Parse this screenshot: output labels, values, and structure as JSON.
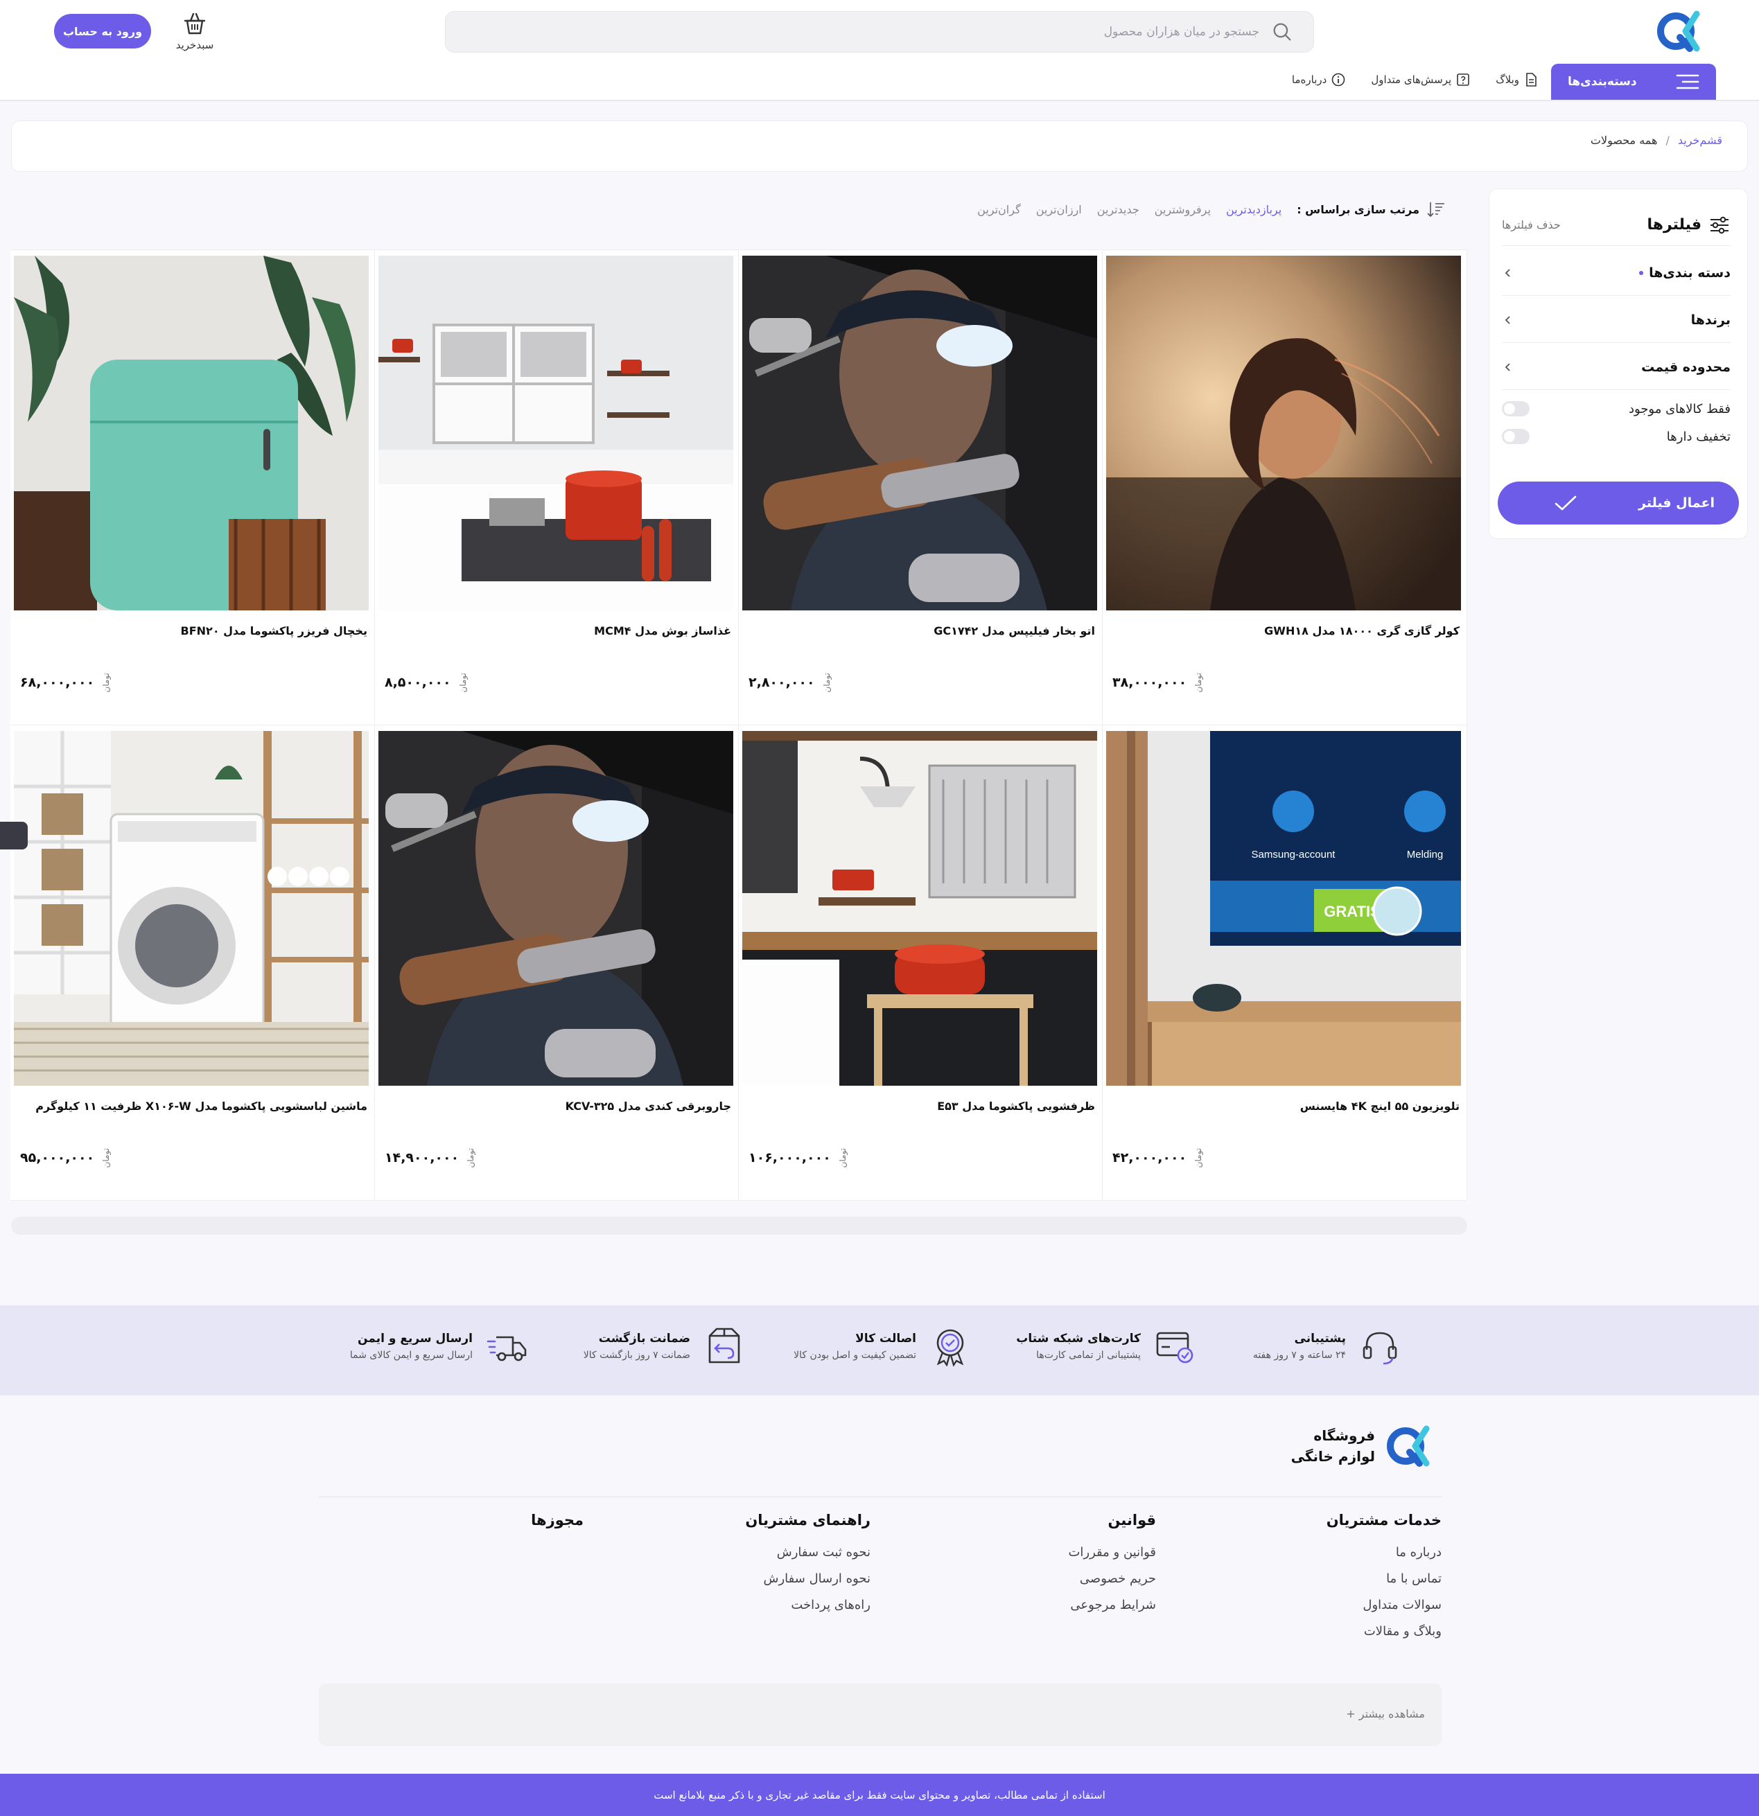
{
  "header": {
    "search_placeholder": "جستجو در میان هزاران محصول",
    "cart_label": "سبدخرید",
    "login_label": "ورود به حساب",
    "categories_label": "دسته‌بندی‌ها",
    "nav": [
      {
        "label": "وبلاگ",
        "icon": "document-icon"
      },
      {
        "label": "پرسش‌های متداول",
        "icon": "question-icon"
      },
      {
        "label": "درباره‌ما",
        "icon": "info-icon"
      }
    ],
    "brand_color": "#6c5ce7"
  },
  "breadcrumb": {
    "home": "قشم‌خرید",
    "sep": "/",
    "current": "همه محصولات"
  },
  "filters": {
    "title": "فیلترها",
    "clear": "حذف فیلترها",
    "rows": [
      "دسته بندی‌ها",
      "برندها",
      "محدوده قیمت"
    ],
    "toggles": [
      "فقط کالاهای موجود",
      "تخفیف دارها"
    ],
    "apply": "اعمال فیلتر"
  },
  "sort": {
    "label": "مرتب سازی براساس :",
    "options": [
      "پربازدیدترین",
      "پرفروشترین",
      "جدیدترین",
      "ارزان‌ترین",
      "گران‌ترین"
    ],
    "active": "پربازدیدترین"
  },
  "products": [
    {
      "title": "کولر گازی گری ۱۸۰۰۰ مدل GWH۱۸",
      "price": "۳۸,۰۰۰,۰۰۰",
      "currency": "تومان",
      "image": "portrait-photo"
    },
    {
      "title": "اتو بخار فیلیپس مدل GC۱۷۴۲",
      "price": "۲,۸۰۰,۰۰۰",
      "currency": "تومان",
      "image": "tools-photo"
    },
    {
      "title": "غذاساز بوش مدل MCM۴",
      "price": "۸,۵۰۰,۰۰۰",
      "currency": "تومان",
      "image": "kitchen-photo"
    },
    {
      "title": "یخچال فریزر پاکشوما مدل BFN۲۰",
      "price": "۶۸,۰۰۰,۰۰۰",
      "currency": "تومان",
      "image": "fridge-photo"
    },
    {
      "title": "تلویزیون ۵۵ اینچ ۴K هایسنس",
      "price": "۴۲,۰۰۰,۰۰۰",
      "currency": "تومان",
      "image": "tv-photo"
    },
    {
      "title": "ظرفشویی پاکشوما مدل E۵۳",
      "price": "۱۰۶,۰۰۰,۰۰۰",
      "currency": "تومان",
      "image": "kitchen2-photo"
    },
    {
      "title": "جاروبرقی کندی مدل KCV-۳۲۵",
      "price": "۱۴,۹۰۰,۰۰۰",
      "currency": "تومان",
      "image": "tools-photo"
    },
    {
      "title": "ماشین لباسشویی پاکشوما مدل X۱۰۶-W ظرفیت ۱۱ کیلوگرم",
      "price": "۹۵,۰۰۰,۰۰۰",
      "currency": "تومان",
      "image": "washer-photo"
    }
  ],
  "tv_screen": {
    "left_label": "Melding",
    "right_label": "Samsung-account",
    "banner": "GRATIS"
  },
  "services": [
    {
      "title": "پشتیبانی",
      "sub": "۲۴ ساعته و ۷ روز هفته",
      "icon": "headset-icon"
    },
    {
      "title": "کارت‌های شبکه شتاب",
      "sub": "پشتیبانی از تمامی کارت‌ها",
      "icon": "card-icon"
    },
    {
      "title": "اصالت کالا",
      "sub": "تضمین کیفیت و اصل بودن کالا",
      "icon": "badge-icon"
    },
    {
      "title": "ضمانت بازگشت",
      "sub": "ضمانت ۷ روز بازگشت کالا",
      "icon": "return-box-icon"
    },
    {
      "title": "ارسال سریع و ایمن",
      "sub": "ارسال سریع و ایمن کالای شما",
      "icon": "truck-icon"
    }
  ],
  "footer": {
    "brand": "فروشگاه لوازم خانگی",
    "columns": [
      {
        "title": "خدمات مشتریان",
        "links": [
          "درباره ما",
          "تماس با ما",
          "سوالات متداول",
          "وبلاگ و مقالات"
        ]
      },
      {
        "title": "قوانین",
        "links": [
          "قوانین و مقررات",
          "حریم خصوصی",
          "شرایط مرجوعی"
        ]
      },
      {
        "title": "راهنمای مشتریان",
        "links": [
          "نحوه ثبت سفارش",
          "نحوه ارسال سفارش",
          "راه‌های پرداخت"
        ]
      },
      {
        "title": "مجوزها",
        "links": []
      }
    ],
    "see_more": "مشاهده بیشتر +",
    "copyright": "استفاده از تمامی مطالب، تصاویر و محتوای سایت فقط برای مقاصد غیر تجاری و با ذکر منبع بلامانع است"
  }
}
